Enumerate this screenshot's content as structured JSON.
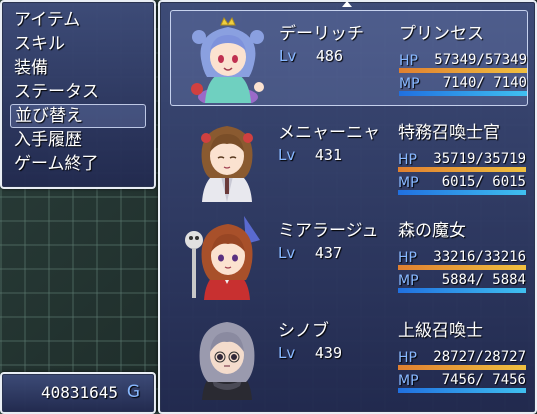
{
  "menu": {
    "items": [
      {
        "label": "アイテム",
        "selected": false
      },
      {
        "label": "スキル",
        "selected": false
      },
      {
        "label": "装備",
        "selected": false
      },
      {
        "label": "ステータス",
        "selected": false
      },
      {
        "label": "並び替え",
        "selected": true
      },
      {
        "label": "入手履歴",
        "selected": false
      },
      {
        "label": "ゲーム終了",
        "selected": false
      }
    ]
  },
  "gold": {
    "value": "40831645",
    "unit": "G"
  },
  "party": [
    {
      "name": "デーリッチ",
      "class": "プリンセス",
      "lv_label": "Lv",
      "level": "486",
      "hp_label": "HP",
      "hp_text": "57349/57349",
      "hp_ratio": 1.0,
      "mp_label": "MP",
      "mp_text": " 7140/ 7140",
      "mp_ratio": 1.0,
      "selected": true,
      "portrait": "portrait-purple-haired-princess"
    },
    {
      "name": "メニャーニャ",
      "class": "特務召喚士官",
      "lv_label": "Lv",
      "level": "431",
      "hp_label": "HP",
      "hp_text": "35719/35719",
      "hp_ratio": 1.0,
      "mp_label": "MP",
      "mp_text": " 6015/ 6015",
      "mp_ratio": 1.0,
      "selected": false,
      "portrait": "portrait-brown-haired-officer"
    },
    {
      "name": "ミアラージュ",
      "class": "森の魔女",
      "lv_label": "Lv",
      "level": "437",
      "hp_label": "HP",
      "hp_text": "33216/33216",
      "hp_ratio": 1.0,
      "mp_label": "MP",
      "mp_text": " 5884/ 5884",
      "mp_ratio": 1.0,
      "selected": false,
      "portrait": "portrait-forest-witch"
    },
    {
      "name": "シノブ",
      "class": "上級召喚士",
      "lv_label": "Lv",
      "level": "439",
      "hp_label": "HP",
      "hp_text": "28727/28727",
      "hp_ratio": 1.0,
      "mp_label": "MP",
      "mp_text": " 7456/ 7456",
      "mp_ratio": 1.0,
      "selected": false,
      "portrait": "portrait-grey-haired-summoner"
    }
  ],
  "colors": {
    "system_label": "#88b8ff",
    "hp_gauge": "#f0a040",
    "mp_gauge": "#40a0f0",
    "window_border": "#e9eef5"
  }
}
